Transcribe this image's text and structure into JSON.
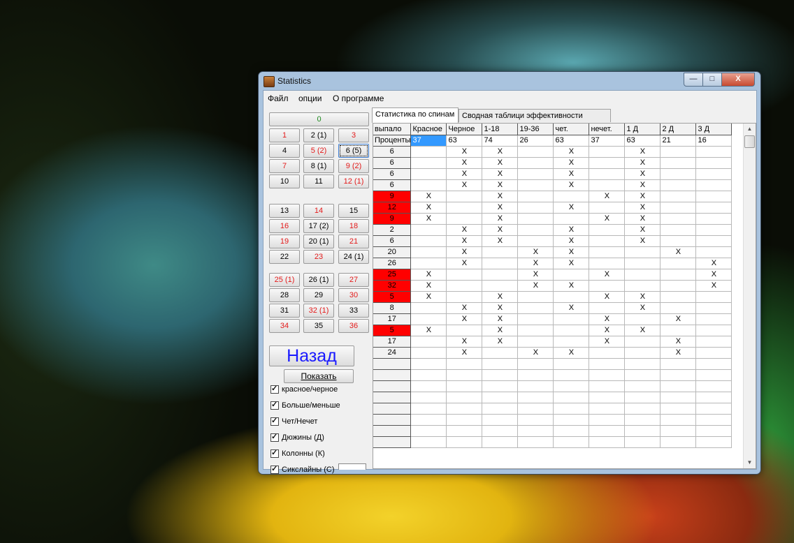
{
  "window": {
    "title": "Statistics"
  },
  "titlebar_buttons": {
    "minimize": "—",
    "maximize": "□",
    "close": "X"
  },
  "menu": [
    "Файл",
    "опции",
    "О программе"
  ],
  "numbers": [
    {
      "label": "0",
      "color": "green"
    },
    {
      "label": "1",
      "color": "red"
    },
    {
      "label": "2 (1)",
      "color": "black"
    },
    {
      "label": "3",
      "color": "red"
    },
    {
      "label": "4",
      "color": "black"
    },
    {
      "label": "5 (2)",
      "color": "red"
    },
    {
      "label": "6 (5)",
      "color": "black"
    },
    {
      "label": "7",
      "color": "red"
    },
    {
      "label": "8 (1)",
      "color": "black"
    },
    {
      "label": "9 (2)",
      "color": "red"
    },
    {
      "label": "10",
      "color": "black"
    },
    {
      "label": "11",
      "color": "black"
    },
    {
      "label": "12 (1)",
      "color": "red"
    },
    {
      "label": "13",
      "color": "black"
    },
    {
      "label": "14",
      "color": "red"
    },
    {
      "label": "15",
      "color": "black"
    },
    {
      "label": "16",
      "color": "red"
    },
    {
      "label": "17 (2)",
      "color": "black"
    },
    {
      "label": "18",
      "color": "red"
    },
    {
      "label": "19",
      "color": "red"
    },
    {
      "label": "20 (1)",
      "color": "black"
    },
    {
      "label": "21",
      "color": "red"
    },
    {
      "label": "22",
      "color": "black"
    },
    {
      "label": "23",
      "color": "red"
    },
    {
      "label": "24 (1)",
      "color": "black"
    },
    {
      "label": "25 (1)",
      "color": "red"
    },
    {
      "label": "26 (1)",
      "color": "black"
    },
    {
      "label": "27",
      "color": "red"
    },
    {
      "label": "28",
      "color": "black"
    },
    {
      "label": "29",
      "color": "black"
    },
    {
      "label": "30",
      "color": "red"
    },
    {
      "label": "31",
      "color": "black"
    },
    {
      "label": "32 (1)",
      "color": "red"
    },
    {
      "label": "33",
      "color": "black"
    },
    {
      "label": "34",
      "color": "red"
    },
    {
      "label": "35",
      "color": "black"
    },
    {
      "label": "36",
      "color": "red"
    }
  ],
  "focused_number": "6 (5)",
  "back_button": "Назад",
  "show_button": "Показать",
  "checkboxes": [
    {
      "label": "красное/черное",
      "checked": true
    },
    {
      "label": "Больше/меньше",
      "checked": true
    },
    {
      "label": "Чет/Нечет",
      "checked": true
    },
    {
      "label": "Дюжины (Д)",
      "checked": true
    },
    {
      "label": "Колонны (К)",
      "checked": true
    },
    {
      "label": "Сикслайны (С)",
      "checked": true
    }
  ],
  "tabs": [
    "Статистика по спинам",
    "Сводная таблици эффективности систем"
  ],
  "active_tab": 0,
  "table": {
    "headers": [
      "выпало",
      "Красное",
      "Черное",
      "1-18",
      "19-36",
      "чет.",
      "нечет.",
      "1 Д",
      "2 Д",
      "3 Д"
    ],
    "percent_row": [
      "Проценты",
      "37",
      "63",
      "74",
      "26",
      "63",
      "37",
      "63",
      "21",
      "16"
    ],
    "rows": [
      {
        "n": "6",
        "red": false,
        "marks": [
          0,
          1,
          1,
          0,
          1,
          0,
          1,
          0,
          0
        ]
      },
      {
        "n": "6",
        "red": false,
        "marks": [
          0,
          1,
          1,
          0,
          1,
          0,
          1,
          0,
          0
        ]
      },
      {
        "n": "6",
        "red": false,
        "marks": [
          0,
          1,
          1,
          0,
          1,
          0,
          1,
          0,
          0
        ]
      },
      {
        "n": "6",
        "red": false,
        "marks": [
          0,
          1,
          1,
          0,
          1,
          0,
          1,
          0,
          0
        ]
      },
      {
        "n": "9",
        "red": true,
        "marks": [
          1,
          0,
          1,
          0,
          0,
          1,
          1,
          0,
          0
        ]
      },
      {
        "n": "12",
        "red": true,
        "marks": [
          1,
          0,
          1,
          0,
          1,
          0,
          1,
          0,
          0
        ]
      },
      {
        "n": "9",
        "red": true,
        "marks": [
          1,
          0,
          1,
          0,
          0,
          1,
          1,
          0,
          0
        ]
      },
      {
        "n": "2",
        "red": false,
        "marks": [
          0,
          1,
          1,
          0,
          1,
          0,
          1,
          0,
          0
        ]
      },
      {
        "n": "6",
        "red": false,
        "marks": [
          0,
          1,
          1,
          0,
          1,
          0,
          1,
          0,
          0
        ]
      },
      {
        "n": "20",
        "red": false,
        "marks": [
          0,
          1,
          0,
          1,
          1,
          0,
          0,
          1,
          0
        ]
      },
      {
        "n": "26",
        "red": false,
        "marks": [
          0,
          1,
          0,
          1,
          1,
          0,
          0,
          0,
          1
        ]
      },
      {
        "n": "25",
        "red": true,
        "marks": [
          1,
          0,
          0,
          1,
          0,
          1,
          0,
          0,
          1
        ]
      },
      {
        "n": "32",
        "red": true,
        "marks": [
          1,
          0,
          0,
          1,
          1,
          0,
          0,
          0,
          1
        ]
      },
      {
        "n": "5",
        "red": true,
        "marks": [
          1,
          0,
          1,
          0,
          0,
          1,
          1,
          0,
          0
        ]
      },
      {
        "n": "8",
        "red": false,
        "marks": [
          0,
          1,
          1,
          0,
          1,
          0,
          1,
          0,
          0
        ]
      },
      {
        "n": "17",
        "red": false,
        "marks": [
          0,
          1,
          1,
          0,
          0,
          1,
          0,
          1,
          0
        ]
      },
      {
        "n": "5",
        "red": true,
        "marks": [
          1,
          0,
          1,
          0,
          0,
          1,
          1,
          0,
          0
        ]
      },
      {
        "n": "17",
        "red": false,
        "marks": [
          0,
          1,
          1,
          0,
          0,
          1,
          0,
          1,
          0
        ]
      },
      {
        "n": "24",
        "red": false,
        "marks": [
          0,
          1,
          0,
          1,
          1,
          0,
          0,
          1,
          0
        ]
      }
    ],
    "mark": "X",
    "empty_rows": 8
  },
  "colors": {
    "red_cell": "#ff0000",
    "selected_cell": "#3399ff",
    "red_text": "#e31a1a",
    "green_text": "#1d8a1d",
    "back_text": "#1a1aff"
  }
}
